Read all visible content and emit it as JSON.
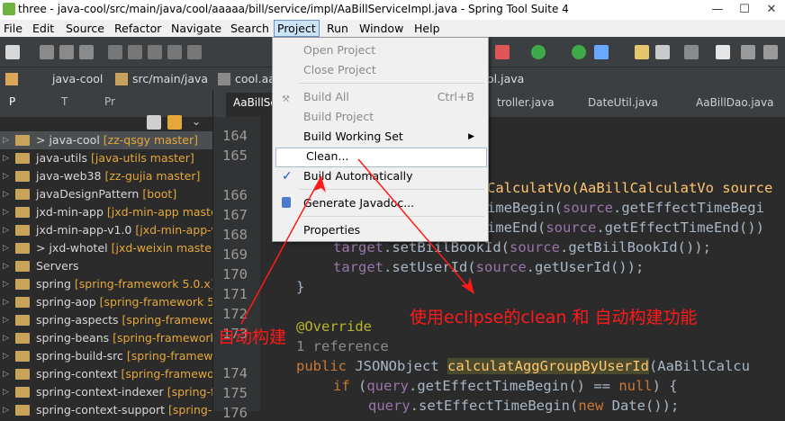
{
  "window": {
    "title": "three - java-cool/src/main/java/cool/aaaaa/bill/service/impl/AaBillServiceImpl.java - Spring Tool Suite 4",
    "minimize": "—",
    "maximize": "☐",
    "close": "✕"
  },
  "menubar": [
    "File",
    "Edit",
    "Source",
    "Refactor",
    "Navigate",
    "Search",
    "Project",
    "Run",
    "Window",
    "Help"
  ],
  "breadcrumb": [
    "java-cool",
    "src/main/java",
    "cool.aa",
    "ol.java"
  ],
  "left_panel": {
    "tabs": [
      "P",
      "T",
      "Pr"
    ],
    "projects": [
      {
        "name": "> java-cool",
        "branch": "[zz-qsgy master]"
      },
      {
        "name": "java-utils",
        "branch": "[java-utils master]"
      },
      {
        "name": "java-web38",
        "branch": "[zz-gujia master]"
      },
      {
        "name": "javaDesignPattern",
        "branch": "[boot]"
      },
      {
        "name": "jxd-min-app",
        "branch": "[jxd-min-app master"
      },
      {
        "name": "jxd-min-app-v1.0",
        "branch": "[jxd-min-app-v1"
      },
      {
        "name": "> jxd-whotel",
        "branch": "[jxd-weixin master]"
      },
      {
        "name": "Servers",
        "branch": ""
      },
      {
        "name": "spring",
        "branch": "[spring-framework 5.0.x]"
      },
      {
        "name": "spring-aop",
        "branch": "[spring-framework 5."
      },
      {
        "name": "spring-aspects",
        "branch": "[spring-framewor"
      },
      {
        "name": "spring-beans",
        "branch": "[spring-framework"
      },
      {
        "name": "spring-build-src",
        "branch": "[spring-framewo"
      },
      {
        "name": "spring-context",
        "branch": "[spring-framewor"
      },
      {
        "name": "spring-context-indexer",
        "branch": "[spring-fr"
      },
      {
        "name": "spring-context-support",
        "branch": "[spring-"
      }
    ]
  },
  "editor": {
    "tabs": [
      "AaBillSe",
      "troller.java",
      "DateUtil.java",
      "AaBillDao.java"
    ],
    "line_numbers": [
      "164",
      "165",
      "166",
      "167",
      "168",
      "169",
      "170",
      "171",
      "172",
      "173",
      "174",
      "175",
      "176"
    ],
    "code": {
      "l166": "CalculatVo(AaBillCalculatVo source",
      "l167a": "imeBegin(",
      "l167b": "source",
      "l167c": ".getEffectTimeBegi",
      "l168a": "imeEnd(",
      "l168b": "source",
      "l168c": ".getEffectTimeEnd())",
      "l169a": "target",
      "l169b": ".setBiilBookId(",
      "l169c": "source",
      "l169d": ".getBiilBookId());",
      "l170a": "target",
      "l170b": ".setUserId(",
      "l170c": "source",
      "l170d": ".getUserId());",
      "l171": "}",
      "l173": "@Override",
      "l173r": "1 reference",
      "l174a": "public",
      "l174b": " JSONObject ",
      "l174c": "calculatAggGroupByUserId",
      "l174d": "(AaBillCalcu",
      "l175a": "if",
      "l175b": " (",
      "l175c": "query",
      "l175d": ".getEffectTimeBegin() == ",
      "l175e": "null",
      "l175f": ") {",
      "l176a": "query",
      "l176b": ".setEffectTimeBegin(",
      "l176c": "new",
      "l176d": " Date());"
    }
  },
  "project_menu": {
    "items": [
      {
        "label": "Open Project",
        "disabled": true
      },
      {
        "label": "Close Project",
        "disabled": true
      },
      {
        "label": "Build All",
        "accel": "Ctrl+B",
        "disabled": true
      },
      {
        "label": "Build Project",
        "disabled": true
      },
      {
        "label": "Build Working Set",
        "submenu": "▶"
      },
      {
        "label": "Clean..."
      },
      {
        "label": "Build Automatically",
        "checked": "✓"
      },
      {
        "label": "Generate Javadoc..."
      },
      {
        "label": "Properties"
      }
    ]
  },
  "annotations": {
    "left": "自动构建",
    "right": "使用eclipse的clean 和 自动构建功能"
  },
  "colors": {
    "annotation": "#ff1a1a",
    "menu_highlight": "#cce4f7",
    "branch": "#e5a73a"
  }
}
